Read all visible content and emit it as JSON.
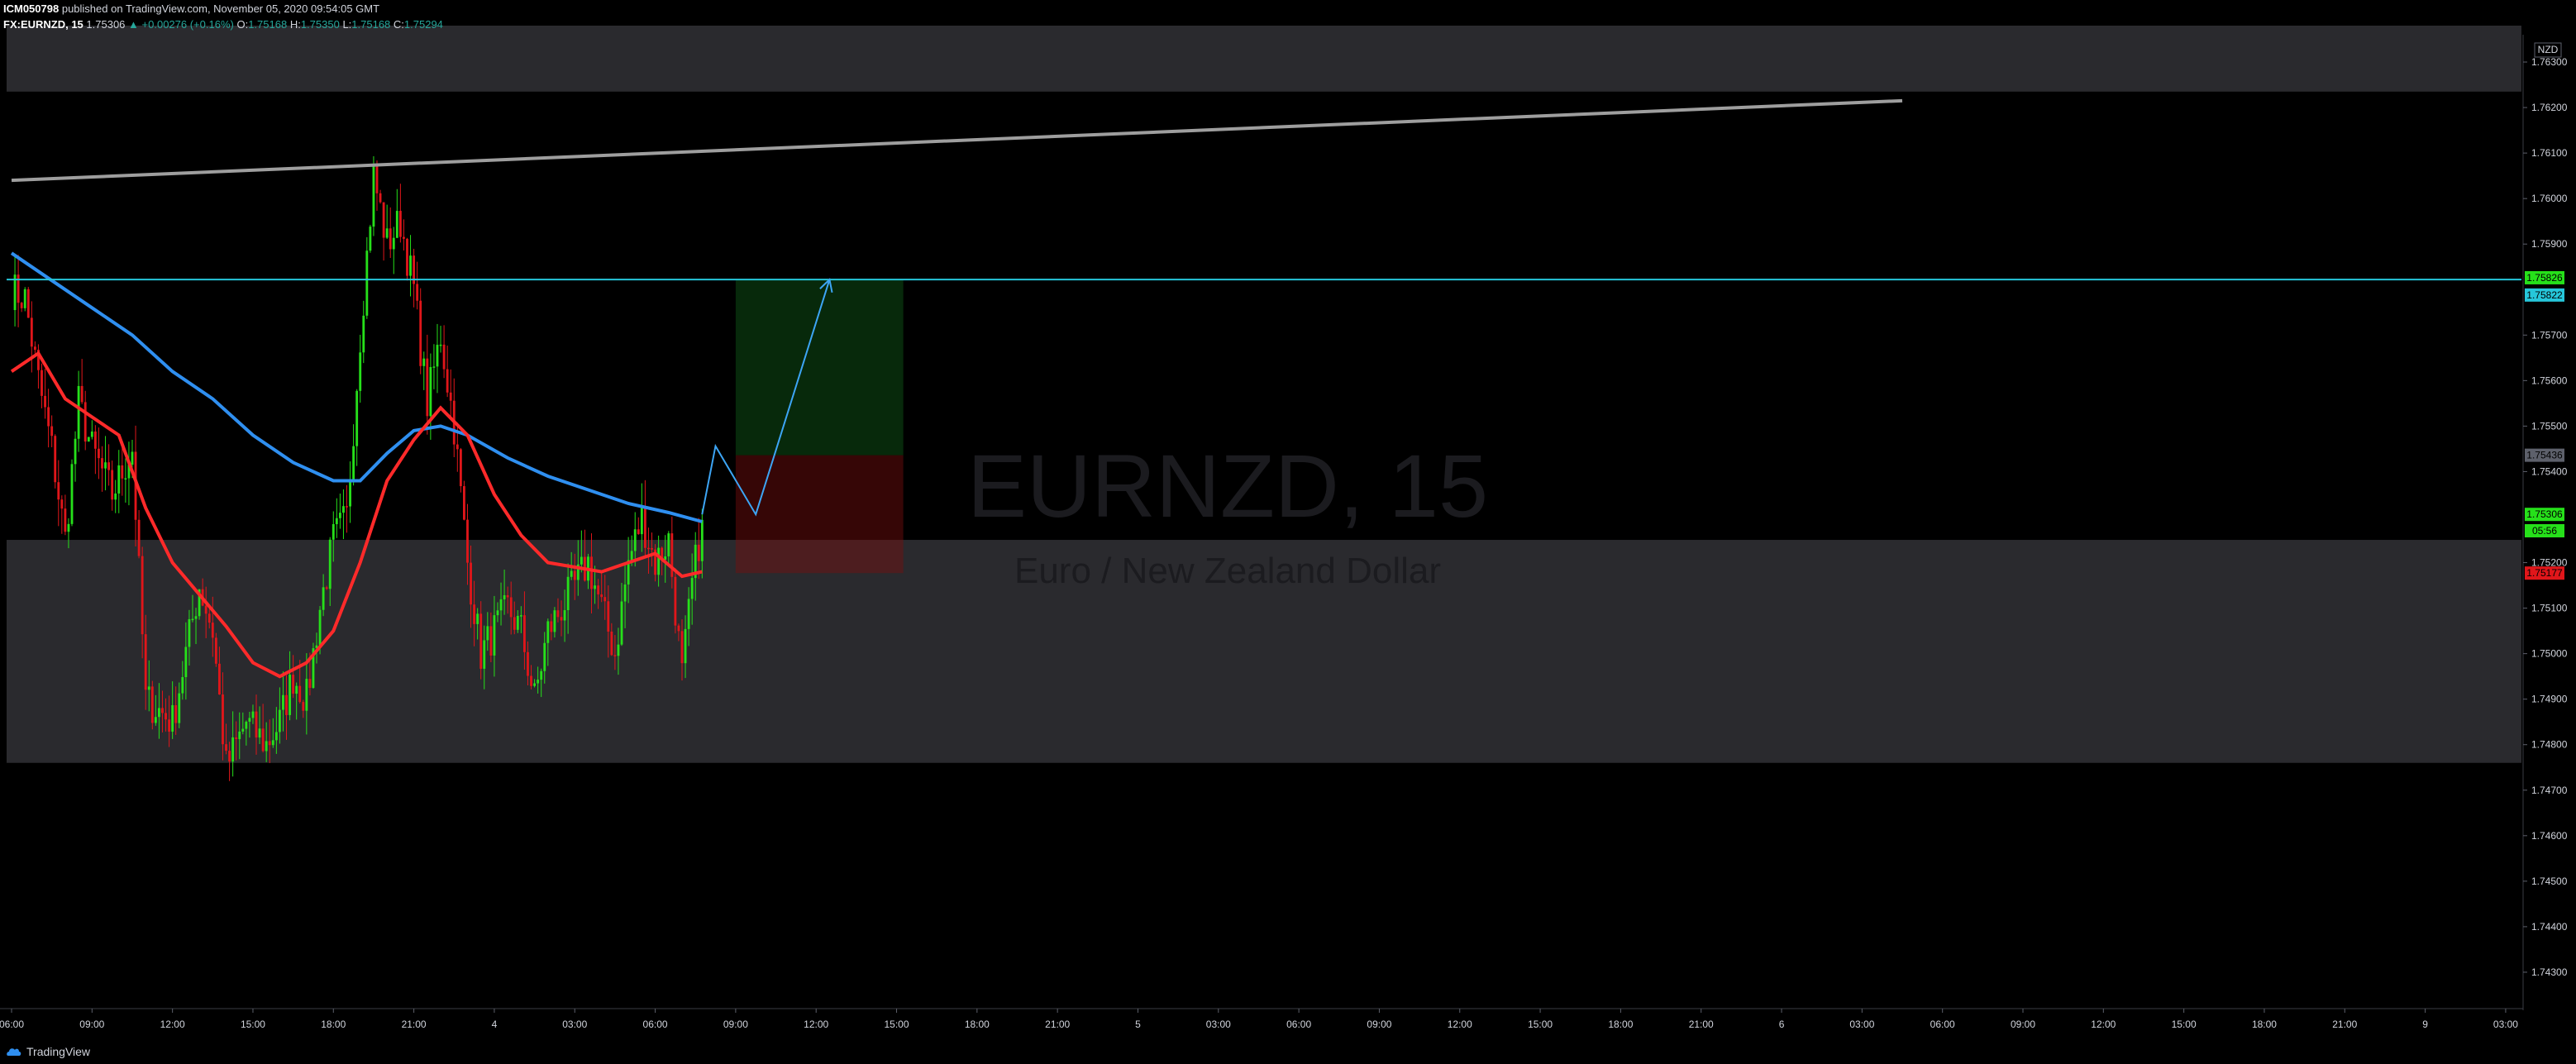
{
  "header": {
    "publisher": "ICM050798",
    "published_text": "published on TradingView.com, November 05, 2020 09:54:05 GMT",
    "symbol": "FX:EURNZD, 15",
    "last_value": "1.75306",
    "change": "▲ +0.00276 (+0.16%)",
    "open_label": "O:",
    "open": "1.75168",
    "high_label": "H:",
    "high": "1.75350",
    "low_label": "L:",
    "low": "1.75168",
    "close_label": "C:",
    "close": "1.75294"
  },
  "watermark": {
    "symbol": "EURNZD, 15",
    "description": "Euro / New Zealand Dollar"
  },
  "footer": {
    "brand": "TradingView"
  },
  "colors": {
    "background": "#000000",
    "bull": "#26e01a",
    "bear": "#e0161a",
    "ma_blue": "#2f8ff0",
    "ma_red": "#ff2a2a",
    "hline": "#26c6da",
    "trendline": "#9e9e9e",
    "zone": "#2a2a2e"
  },
  "chart_data": {
    "type": "candlestick",
    "currency": "NZD",
    "y_ticks": [
      "1.76300",
      "1.76200",
      "1.76100",
      "1.76000",
      "1.75900",
      "1.75700",
      "1.75600",
      "1.75500",
      "1.75400",
      "1.75200",
      "1.75100",
      "1.75000",
      "1.74900",
      "1.74800",
      "1.74700",
      "1.74600",
      "1.74500",
      "1.74400",
      "1.74300"
    ],
    "ylim": [
      1.7422,
      1.7636
    ],
    "x_ticks": [
      "06:00",
      "09:00",
      "12:00",
      "15:00",
      "18:00",
      "21:00",
      "4",
      "03:00",
      "06:00",
      "09:00",
      "12:00",
      "15:00",
      "18:00",
      "21:00",
      "5",
      "03:00",
      "06:00",
      "09:00",
      "12:00",
      "15:00",
      "18:00",
      "21:00",
      "6",
      "03:00",
      "06:00",
      "09:00",
      "12:00",
      "15:00",
      "18:00",
      "21:00",
      "9",
      "03:00"
    ],
    "price_labels": [
      {
        "text": "1.75826",
        "price": 1.75826,
        "color": "#26e01a"
      },
      {
        "text": "1.75822",
        "price": 1.75788,
        "color": "#26c6da"
      },
      {
        "text": "1.75436",
        "price": 1.75436,
        "color": "#5d606b"
      },
      {
        "text": "1.75306",
        "price": 1.75306,
        "color": "#26e01a"
      },
      {
        "text": "05:56",
        "price": 1.7527,
        "color": "#26e01a"
      },
      {
        "text": "1.75177",
        "price": 1.75177,
        "color": "#e0161a"
      }
    ],
    "zones": [
      {
        "from": 1.76235,
        "to": 1.7638
      },
      {
        "from": 1.7476,
        "to": 1.7525
      }
    ],
    "horizontal_line": 1.75822,
    "trendline": {
      "from": {
        "date": "Nov 3 06:00",
        "price": 1.7604
      },
      "to": {
        "date": "Nov 9 03:00",
        "price": 1.76215
      }
    },
    "position": {
      "entry": 1.75436,
      "target": 1.75822,
      "stop": 1.75177,
      "from": "Nov 5 12:00",
      "to": "Nov 6 00:30"
    },
    "projection": [
      {
        "date": "Nov 5 09:30",
        "price": 1.75306
      },
      {
        "date": "Nov 5 10:30",
        "price": 1.75456
      },
      {
        "date": "Nov 5 13:30",
        "price": 1.75306
      },
      {
        "date": "Nov 5 19:00",
        "price": 1.75822
      }
    ],
    "ohlc_anchors": [
      {
        "date": "Nov 3 06:00",
        "close": 1.758
      },
      {
        "date": "Nov 3 07:00",
        "close": 1.7578
      },
      {
        "date": "Nov 3 08:00",
        "close": 1.756
      },
      {
        "date": "Nov 3 09:00",
        "close": 1.7545
      },
      {
        "date": "Nov 3 10:00",
        "close": 1.7525
      },
      {
        "date": "Nov 3 11:00",
        "close": 1.7555
      },
      {
        "date": "Nov 3 12:00",
        "close": 1.7545
      },
      {
        "date": "Nov 3 13:30",
        "close": 1.7535
      },
      {
        "date": "Nov 3 15:00",
        "close": 1.7545
      },
      {
        "date": "Nov 3 16:00",
        "close": 1.749
      },
      {
        "date": "Nov 3 18:00",
        "close": 1.7485
      },
      {
        "date": "Nov 3 20:00",
        "close": 1.7515
      },
      {
        "date": "Nov 3 21:00",
        "close": 1.7505
      },
      {
        "date": "Nov 3 22:00",
        "close": 1.7475
      },
      {
        "date": "Nov 3 23:30",
        "close": 1.7485
      },
      {
        "date": "Nov 4 01:00",
        "close": 1.748
      },
      {
        "date": "Nov 4 02:00",
        "close": 1.7485
      },
      {
        "date": "Nov 4 03:00",
        "close": 1.7495
      },
      {
        "date": "Nov 4 04:00",
        "close": 1.749
      },
      {
        "date": "Nov 4 05:00",
        "close": 1.751
      },
      {
        "date": "Nov 4 06:00",
        "close": 1.7525
      },
      {
        "date": "Nov 4 07:00",
        "close": 1.753
      },
      {
        "date": "Nov 4 08:00",
        "close": 1.757
      },
      {
        "date": "Nov 4 09:00",
        "close": 1.7605
      },
      {
        "date": "Nov 4 10:00",
        "close": 1.759
      },
      {
        "date": "Nov 4 11:00",
        "close": 1.7595
      },
      {
        "date": "Nov 4 12:00",
        "close": 1.758
      },
      {
        "date": "Nov 4 13:00",
        "close": 1.7555
      },
      {
        "date": "Nov 4 14:00",
        "close": 1.757
      },
      {
        "date": "Nov 4 15:00",
        "close": 1.755
      },
      {
        "date": "Nov 4 16:00",
        "close": 1.752
      },
      {
        "date": "Nov 4 17:00",
        "close": 1.75
      },
      {
        "date": "Nov 4 18:00",
        "close": 1.7505
      },
      {
        "date": "Nov 4 19:00",
        "close": 1.751
      },
      {
        "date": "Nov 4 20:00",
        "close": 1.7505
      },
      {
        "date": "Nov 4 21:00",
        "close": 1.749
      },
      {
        "date": "Nov 4 22:00",
        "close": 1.7505
      },
      {
        "date": "Nov 5 00:00",
        "close": 1.7515
      },
      {
        "date": "Nov 5 01:00",
        "close": 1.752
      },
      {
        "date": "Nov 5 02:00",
        "close": 1.751
      },
      {
        "date": "Nov 5 03:00",
        "close": 1.75
      },
      {
        "date": "Nov 5 04:00",
        "close": 1.752
      },
      {
        "date": "Nov 5 05:00",
        "close": 1.753
      },
      {
        "date": "Nov 5 06:00",
        "close": 1.752
      },
      {
        "date": "Nov 5 07:00",
        "close": 1.7525
      },
      {
        "date": "Nov 5 08:00",
        "close": 1.7495
      },
      {
        "date": "Nov 5 08:45",
        "close": 1.7515
      },
      {
        "date": "Nov 5 09:30",
        "close": 1.75294
      }
    ],
    "moving_averages": [
      {
        "color": "#2f8ff0",
        "points": [
          {
            "date": "Nov 3 06:00",
            "price": 1.7588
          },
          {
            "date": "Nov 3 09:00",
            "price": 1.7582
          },
          {
            "date": "Nov 3 12:00",
            "price": 1.7576
          },
          {
            "date": "Nov 3 15:00",
            "price": 1.757
          },
          {
            "date": "Nov 3 18:00",
            "price": 1.7562
          },
          {
            "date": "Nov 3 21:00",
            "price": 1.7556
          },
          {
            "date": "Nov 4 00:00",
            "price": 1.7548
          },
          {
            "date": "Nov 4 03:00",
            "price": 1.7542
          },
          {
            "date": "Nov 4 06:00",
            "price": 1.7538
          },
          {
            "date": "Nov 4 08:00",
            "price": 1.7538
          },
          {
            "date": "Nov 4 10:00",
            "price": 1.7544
          },
          {
            "date": "Nov 4 12:00",
            "price": 1.7549
          },
          {
            "date": "Nov 4 14:00",
            "price": 1.755
          },
          {
            "date": "Nov 4 16:00",
            "price": 1.7548
          },
          {
            "date": "Nov 4 19:00",
            "price": 1.7543
          },
          {
            "date": "Nov 4 22:00",
            "price": 1.7539
          },
          {
            "date": "Nov 5 01:00",
            "price": 1.7536
          },
          {
            "date": "Nov 5 04:00",
            "price": 1.7533
          },
          {
            "date": "Nov 5 07:00",
            "price": 1.7531
          },
          {
            "date": "Nov 5 09:30",
            "price": 1.7529
          }
        ]
      },
      {
        "color": "#ff2a2a",
        "points": [
          {
            "date": "Nov 3 06:00",
            "price": 1.7562
          },
          {
            "date": "Nov 3 08:00",
            "price": 1.7566
          },
          {
            "date": "Nov 3 10:00",
            "price": 1.7556
          },
          {
            "date": "Nov 3 12:00",
            "price": 1.7552
          },
          {
            "date": "Nov 3 14:00",
            "price": 1.7548
          },
          {
            "date": "Nov 3 16:00",
            "price": 1.7532
          },
          {
            "date": "Nov 3 18:00",
            "price": 1.752
          },
          {
            "date": "Nov 3 20:00",
            "price": 1.7513
          },
          {
            "date": "Nov 3 22:00",
            "price": 1.7506
          },
          {
            "date": "Nov 4 00:00",
            "price": 1.7498
          },
          {
            "date": "Nov 4 02:00",
            "price": 1.7495
          },
          {
            "date": "Nov 4 04:00",
            "price": 1.7498
          },
          {
            "date": "Nov 4 06:00",
            "price": 1.7505
          },
          {
            "date": "Nov 4 08:00",
            "price": 1.752
          },
          {
            "date": "Nov 4 10:00",
            "price": 1.7538
          },
          {
            "date": "Nov 4 12:00",
            "price": 1.7547
          },
          {
            "date": "Nov 4 14:00",
            "price": 1.7554
          },
          {
            "date": "Nov 4 16:00",
            "price": 1.7548
          },
          {
            "date": "Nov 4 18:00",
            "price": 1.7535
          },
          {
            "date": "Nov 4 20:00",
            "price": 1.7526
          },
          {
            "date": "Nov 4 22:00",
            "price": 1.752
          },
          {
            "date": "Nov 5 00:00",
            "price": 1.7519
          },
          {
            "date": "Nov 5 02:00",
            "price": 1.7518
          },
          {
            "date": "Nov 5 04:00",
            "price": 1.752
          },
          {
            "date": "Nov 5 06:00",
            "price": 1.7522
          },
          {
            "date": "Nov 5 08:00",
            "price": 1.7517
          },
          {
            "date": "Nov 5 09:30",
            "price": 1.7518
          }
        ]
      }
    ]
  }
}
